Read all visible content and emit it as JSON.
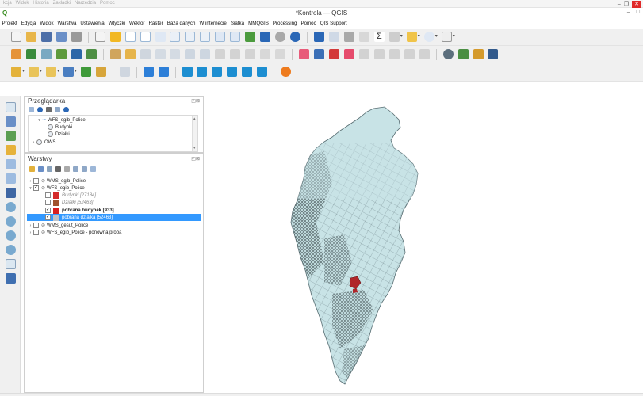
{
  "background_window": {
    "menu": [
      "kcja",
      "Widok",
      "Historia",
      "Zakładki",
      "Narzędzia",
      "Pomoc"
    ],
    "minimize": "–",
    "maximize": "❐"
  },
  "window": {
    "title": "*Kontrola — QGIS",
    "minimize": "–",
    "maximize": "□"
  },
  "menubar": [
    "Projekt",
    "Edycja",
    "Widok",
    "Warstwa",
    "Ustawienia",
    "Wtyczki",
    "Wektor",
    "Raster",
    "Baza danych",
    "W internecie",
    "Siatka",
    "MMQGIS",
    "Processing",
    "Pomoc",
    "QIS Support"
  ],
  "browser_panel": {
    "title": "Przeglądarka",
    "buttons": "◰⊠",
    "items": [
      {
        "label": "WFS_egib_Police"
      },
      {
        "label": "Budynki"
      },
      {
        "label": "Działki"
      },
      {
        "label": "OWS"
      }
    ]
  },
  "layers_panel": {
    "title": "Warstwy",
    "buttons": "◰⊠",
    "layers": [
      {
        "label": "WMS_egib_Police",
        "checked": false
      },
      {
        "label": "WFS_egib_Police",
        "checked": true
      },
      {
        "label": "Budynki [27184]",
        "checked": false,
        "color": "#d42b2b"
      },
      {
        "label": "Działki [52463]",
        "checked": false,
        "color": "#a0522d"
      },
      {
        "label": "pobrana budynek [933]",
        "checked": true,
        "color": "#d82020"
      },
      {
        "label": "pobrana działka [52463]",
        "checked": true,
        "color": "#bfc3c9"
      },
      {
        "label": "WMS_gesut_Police",
        "checked": false
      },
      {
        "label": "WFS_egib_Police - ponowna próba",
        "checked": false
      }
    ]
  },
  "icons": {
    "toolbar": [
      "new-project-icon",
      "open-project-icon",
      "save-project-icon",
      "pan-icon",
      "zoom-in-icon",
      "zoom-out-icon",
      "identify-icon",
      "refresh-icon",
      "field-calculator-icon",
      "statistics-icon",
      "add-vector-layer-icon",
      "add-raster-layer-icon",
      "add-wms-layer-icon",
      "python-console-icon"
    ],
    "left_toolbar": [
      "add-vector-icon",
      "add-raster-icon",
      "add-mesh-icon",
      "add-delimited-text-icon",
      "add-spatialite-icon",
      "add-virtual-layer-icon",
      "add-postgis-icon",
      "add-mssql-icon",
      "add-wms-icon",
      "add-wcs-icon",
      "add-wfs-icon",
      "add-vector-tile-icon",
      "new-geopackage-icon"
    ]
  },
  "colors": {
    "map_polygon_fill": "#c8e3e6",
    "map_polygon_stroke": "#556b70",
    "selected_layer": "#3399ff",
    "buildings": "#d42b2b"
  }
}
